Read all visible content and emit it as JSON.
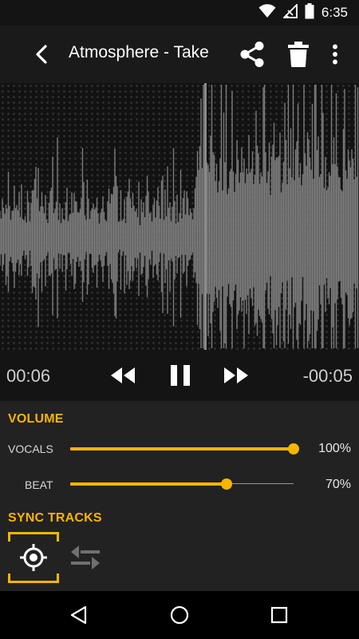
{
  "status_bar": {
    "time": "6:35"
  },
  "header": {
    "title": "Atmosphere - Take"
  },
  "transport": {
    "elapsed": "00:06",
    "remaining": "-00:05",
    "playhead_fraction": 0.57
  },
  "volume": {
    "title": "VOLUME",
    "tracks": [
      {
        "label": "VOCALS",
        "value_text": "100%",
        "value": 1.0
      },
      {
        "label": "BEAT",
        "value_text": "70%",
        "value": 0.7
      }
    ]
  },
  "sync": {
    "title": "SYNC TRACKS"
  },
  "colors": {
    "accent": "#f7b500",
    "wave_gray": "#7b7b7b",
    "wave_core": "#fff7dc"
  }
}
